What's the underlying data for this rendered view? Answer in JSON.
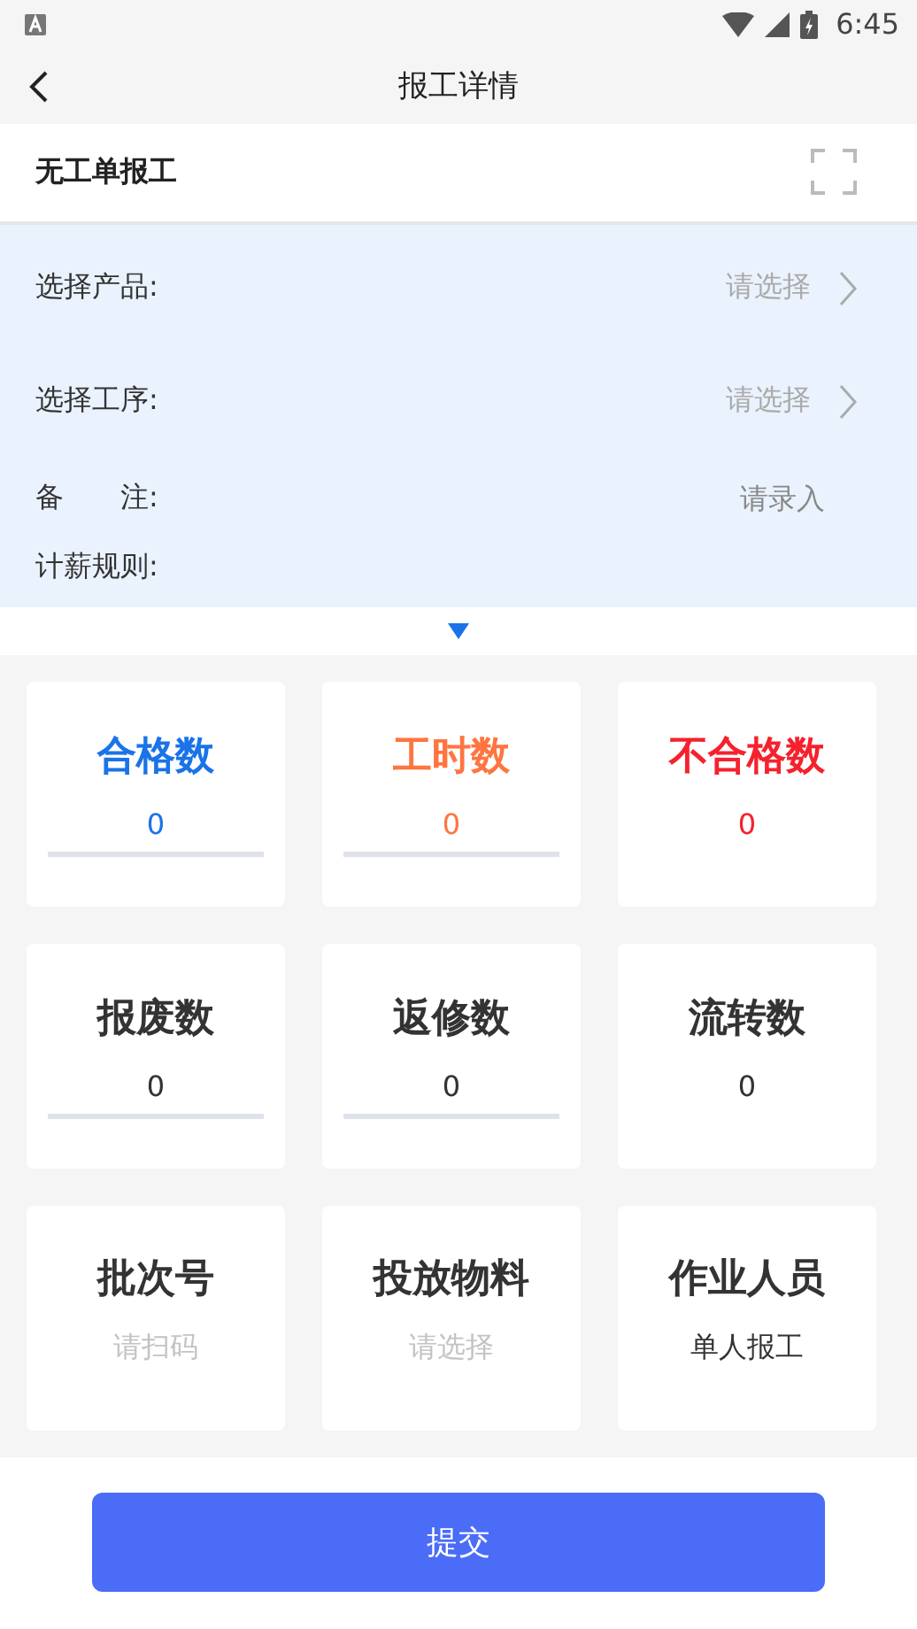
{
  "status_bar": {
    "time": "6:45"
  },
  "header": {
    "title": "报工详情"
  },
  "mode": {
    "label": "无工单报工"
  },
  "form": [
    {
      "kind": "picker",
      "label": "选择产品:",
      "placeholder": "请选择"
    },
    {
      "kind": "picker",
      "label": "选择工序:",
      "placeholder": "请选择"
    },
    {
      "kind": "input",
      "label": "备　　注:",
      "placeholder": "请录入"
    },
    {
      "kind": "text",
      "label": "计薪规则:"
    }
  ],
  "collapse": {
    "expanded": true
  },
  "cards": [
    {
      "title": "合格数",
      "color": "#1a73e8",
      "value": "0",
      "underlined": true
    },
    {
      "title": "工时数",
      "color": "#ff7540",
      "value": "0",
      "underlined": true
    },
    {
      "title": "不合格数",
      "color": "#f5222d",
      "value": "0",
      "underlined": false
    },
    {
      "title": "报废数",
      "color": "#333333",
      "value": "0",
      "underlined": true
    },
    {
      "title": "返修数",
      "color": "#333333",
      "value": "0",
      "underlined": true
    },
    {
      "title": "流转数",
      "color": "#333333",
      "value": "0",
      "underlined": false
    },
    {
      "title": "批次号",
      "color": "#333333",
      "placeholder": "请扫码",
      "underlined": false
    },
    {
      "title": "投放物料",
      "color": "#333333",
      "placeholder": "请选择",
      "underlined": false
    },
    {
      "title": "作业人员",
      "color": "#333333",
      "value": "单人报工",
      "underlined": false
    }
  ],
  "submit": {
    "label": "提交"
  }
}
